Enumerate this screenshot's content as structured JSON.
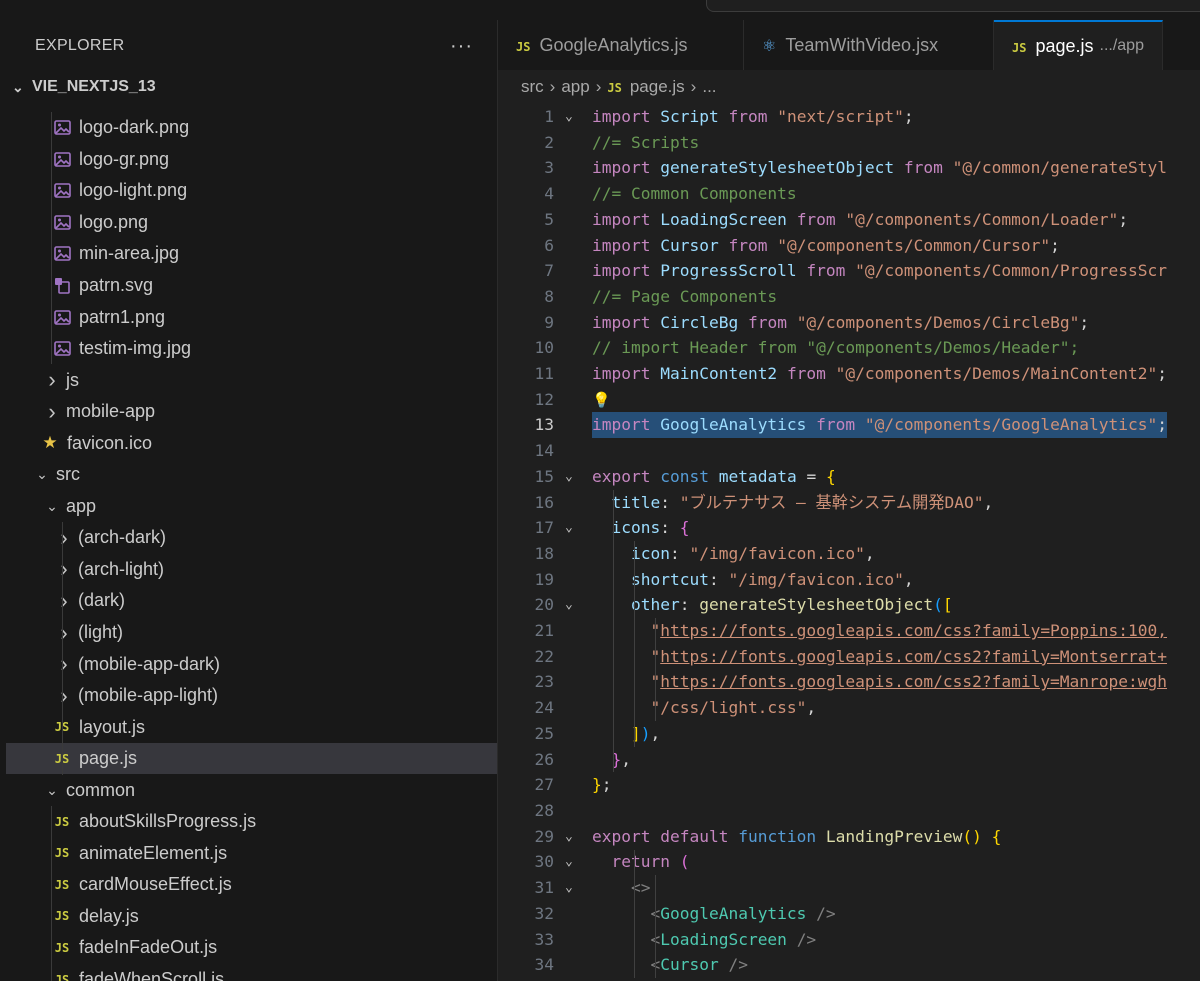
{
  "explorer": {
    "title": "EXPLORER",
    "more_label": "···",
    "project": "VIE_NEXTJS_13"
  },
  "tree": [
    {
      "label": "logo-dark.png",
      "icon": "image-icon",
      "depth": 2,
      "kind": "file"
    },
    {
      "label": "logo-gr.png",
      "icon": "image-icon",
      "depth": 2,
      "kind": "file"
    },
    {
      "label": "logo-light.png",
      "icon": "image-icon",
      "depth": 2,
      "kind": "file"
    },
    {
      "label": "logo.png",
      "icon": "image-icon",
      "depth": 2,
      "kind": "file"
    },
    {
      "label": "min-area.jpg",
      "icon": "image-icon",
      "depth": 2,
      "kind": "file"
    },
    {
      "label": "patrn.svg",
      "icon": "svg-icon",
      "depth": 2,
      "kind": "file"
    },
    {
      "label": "patrn1.png",
      "icon": "image-icon",
      "depth": 2,
      "kind": "file"
    },
    {
      "label": "testim-img.jpg",
      "icon": "image-icon",
      "depth": 2,
      "kind": "file"
    },
    {
      "label": "js",
      "icon": "chevron-right-icon",
      "depth": 1,
      "kind": "folder-collapsed"
    },
    {
      "label": "mobile-app",
      "icon": "chevron-right-icon",
      "depth": 1,
      "kind": "folder-collapsed"
    },
    {
      "label": "favicon.ico",
      "icon": "star-icon",
      "depth": 1,
      "kind": "file"
    },
    {
      "label": "src",
      "icon": "chevron-down-icon",
      "depth": 0,
      "kind": "folder-open"
    },
    {
      "label": "app",
      "icon": "chevron-down-icon",
      "depth": 1,
      "kind": "folder-open"
    },
    {
      "label": "(arch-dark)",
      "icon": "chevron-right-icon",
      "depth": 2,
      "kind": "folder-collapsed"
    },
    {
      "label": "(arch-light)",
      "icon": "chevron-right-icon",
      "depth": 2,
      "kind": "folder-collapsed"
    },
    {
      "label": "(dark)",
      "icon": "chevron-right-icon",
      "depth": 2,
      "kind": "folder-collapsed"
    },
    {
      "label": "(light)",
      "icon": "chevron-right-icon",
      "depth": 2,
      "kind": "folder-collapsed"
    },
    {
      "label": "(mobile-app-dark)",
      "icon": "chevron-right-icon",
      "depth": 2,
      "kind": "folder-collapsed"
    },
    {
      "label": "(mobile-app-light)",
      "icon": "chevron-right-icon",
      "depth": 2,
      "kind": "folder-collapsed"
    },
    {
      "label": "layout.js",
      "icon": "js-icon",
      "depth": 2,
      "kind": "file"
    },
    {
      "label": "page.js",
      "icon": "js-icon",
      "depth": 2,
      "kind": "file",
      "selected": true
    },
    {
      "label": "common",
      "icon": "chevron-down-icon",
      "depth": 1,
      "kind": "folder-open"
    },
    {
      "label": "aboutSkillsProgress.js",
      "icon": "js-icon",
      "depth": 2,
      "kind": "file"
    },
    {
      "label": "animateElement.js",
      "icon": "js-icon",
      "depth": 2,
      "kind": "file"
    },
    {
      "label": "cardMouseEffect.js",
      "icon": "js-icon",
      "depth": 2,
      "kind": "file"
    },
    {
      "label": "delay.js",
      "icon": "js-icon",
      "depth": 2,
      "kind": "file"
    },
    {
      "label": "fadeInFadeOut.js",
      "icon": "js-icon",
      "depth": 2,
      "kind": "file"
    },
    {
      "label": "fadeWhenScroll.js",
      "icon": "js-icon",
      "depth": 2,
      "kind": "file"
    }
  ],
  "tabs": [
    {
      "label": "GoogleAnalytics.js",
      "icon": "js-icon",
      "active": false
    },
    {
      "label": "TeamWithVideo.jsx",
      "icon": "react-icon",
      "active": false
    },
    {
      "label": "page.js",
      "path": ".../app",
      "icon": "js-icon",
      "active": true
    }
  ],
  "breadcrumb": [
    "src",
    "app",
    "page.js",
    "..."
  ],
  "current_line": 13,
  "code": [
    {
      "n": 1,
      "fold": "v",
      "t": [
        [
          "kw",
          "import "
        ],
        [
          "id",
          "Script "
        ],
        [
          "kw",
          "from "
        ],
        [
          "str",
          "\"next/script\""
        ],
        [
          "pun",
          ";"
        ]
      ]
    },
    {
      "n": 2,
      "t": [
        [
          "cm",
          "//= Scripts"
        ]
      ]
    },
    {
      "n": 3,
      "t": [
        [
          "kw",
          "import "
        ],
        [
          "id",
          "generateStylesheetObject "
        ],
        [
          "kw",
          "from "
        ],
        [
          "str",
          "\"@/common/generateStyl"
        ]
      ]
    },
    {
      "n": 4,
      "t": [
        [
          "cm",
          "//= Common Components"
        ]
      ]
    },
    {
      "n": 5,
      "t": [
        [
          "kw",
          "import "
        ],
        [
          "id",
          "LoadingScreen "
        ],
        [
          "kw",
          "from "
        ],
        [
          "str",
          "\"@/components/Common/Loader\""
        ],
        [
          "pun",
          ";"
        ]
      ]
    },
    {
      "n": 6,
      "t": [
        [
          "kw",
          "import "
        ],
        [
          "id",
          "Cursor "
        ],
        [
          "kw",
          "from "
        ],
        [
          "str",
          "\"@/components/Common/Cursor\""
        ],
        [
          "pun",
          ";"
        ]
      ]
    },
    {
      "n": 7,
      "t": [
        [
          "kw",
          "import "
        ],
        [
          "id",
          "ProgressScroll "
        ],
        [
          "kw",
          "from "
        ],
        [
          "str",
          "\"@/components/Common/ProgressScr"
        ]
      ]
    },
    {
      "n": 8,
      "t": [
        [
          "cm",
          "//= Page Components"
        ]
      ]
    },
    {
      "n": 9,
      "t": [
        [
          "kw",
          "import "
        ],
        [
          "id",
          "CircleBg "
        ],
        [
          "kw",
          "from "
        ],
        [
          "str",
          "\"@/components/Demos/CircleBg\""
        ],
        [
          "pun",
          ";"
        ]
      ]
    },
    {
      "n": 10,
      "t": [
        [
          "cm",
          "// import Header from \"@/components/Demos/Header\";"
        ]
      ]
    },
    {
      "n": 11,
      "t": [
        [
          "kw",
          "import "
        ],
        [
          "id",
          "MainContent2 "
        ],
        [
          "kw",
          "from "
        ],
        [
          "str",
          "\"@/components/Demos/MainContent2\""
        ],
        [
          "pun",
          ";"
        ]
      ]
    },
    {
      "n": 12,
      "bulb": true,
      "t": []
    },
    {
      "n": 13,
      "hl": true,
      "t": [
        [
          "kw",
          "import "
        ],
        [
          "id",
          "GoogleAnalytics "
        ],
        [
          "kw",
          "from "
        ],
        [
          "str",
          "\"@/components/GoogleAnalytics\""
        ],
        [
          "pun",
          ";"
        ]
      ]
    },
    {
      "n": 14,
      "t": []
    },
    {
      "n": 15,
      "fold": "v",
      "t": [
        [
          "kw",
          "export "
        ],
        [
          "kb",
          "const "
        ],
        [
          "id",
          "metadata "
        ],
        [
          "pun",
          "= "
        ],
        [
          "br1",
          "{"
        ]
      ]
    },
    {
      "n": 16,
      "t": [
        [
          "pun",
          "  "
        ],
        [
          "id",
          "title"
        ],
        [
          "pun",
          ": "
        ],
        [
          "str",
          "\"ブルテナサス – 基幹システム開発DAO\""
        ],
        [
          "pun",
          ","
        ]
      ]
    },
    {
      "n": 17,
      "fold": "v",
      "t": [
        [
          "pun",
          "  "
        ],
        [
          "id",
          "icons"
        ],
        [
          "pun",
          ": "
        ],
        [
          "br2",
          "{"
        ]
      ]
    },
    {
      "n": 18,
      "t": [
        [
          "pun",
          "    "
        ],
        [
          "id",
          "icon"
        ],
        [
          "pun",
          ": "
        ],
        [
          "str",
          "\"/img/favicon.ico\""
        ],
        [
          "pun",
          ","
        ]
      ]
    },
    {
      "n": 19,
      "t": [
        [
          "pun",
          "    "
        ],
        [
          "id",
          "shortcut"
        ],
        [
          "pun",
          ": "
        ],
        [
          "str",
          "\"/img/favicon.ico\""
        ],
        [
          "pun",
          ","
        ]
      ]
    },
    {
      "n": 20,
      "fold": "v",
      "t": [
        [
          "pun",
          "    "
        ],
        [
          "id",
          "other"
        ],
        [
          "pun",
          ": "
        ],
        [
          "fn",
          "generateStylesheetObject"
        ],
        [
          "br3",
          "("
        ],
        [
          "br1",
          "["
        ]
      ]
    },
    {
      "n": 21,
      "t": [
        [
          "pun",
          "      "
        ],
        [
          "str",
          "\""
        ],
        [
          "ul",
          "https://fonts.googleapis.com/css?family=Poppins:100,"
        ]
      ]
    },
    {
      "n": 22,
      "t": [
        [
          "pun",
          "      "
        ],
        [
          "str",
          "\""
        ],
        [
          "ul",
          "https://fonts.googleapis.com/css2?family=Montserrat+"
        ]
      ]
    },
    {
      "n": 23,
      "t": [
        [
          "pun",
          "      "
        ],
        [
          "str",
          "\""
        ],
        [
          "ul",
          "https://fonts.googleapis.com/css2?family=Manrope:wgh"
        ]
      ]
    },
    {
      "n": 24,
      "t": [
        [
          "pun",
          "      "
        ],
        [
          "str",
          "\"/css/light.css\""
        ],
        [
          "pun",
          ","
        ]
      ]
    },
    {
      "n": 25,
      "t": [
        [
          "pun",
          "    "
        ],
        [
          "br1",
          "]"
        ],
        [
          "br3",
          ")"
        ],
        [
          "pun",
          ","
        ]
      ]
    },
    {
      "n": 26,
      "t": [
        [
          "pun",
          "  "
        ],
        [
          "br2",
          "}"
        ],
        [
          "pun",
          ","
        ]
      ]
    },
    {
      "n": 27,
      "t": [
        [
          "br1",
          "}"
        ],
        [
          "pun",
          ";"
        ]
      ]
    },
    {
      "n": 28,
      "t": []
    },
    {
      "n": 29,
      "fold": "v",
      "t": [
        [
          "kw",
          "export "
        ],
        [
          "kw",
          "default "
        ],
        [
          "kb",
          "function "
        ],
        [
          "fn",
          "LandingPreview"
        ],
        [
          "br1",
          "() {"
        ]
      ]
    },
    {
      "n": 30,
      "fold": "v",
      "t": [
        [
          "pun",
          "  "
        ],
        [
          "kw",
          "return "
        ],
        [
          "br2",
          "("
        ]
      ]
    },
    {
      "n": 31,
      "fold": "v",
      "t": [
        [
          "pun",
          "    "
        ],
        [
          "ang",
          "<>"
        ]
      ]
    },
    {
      "n": 32,
      "t": [
        [
          "pun",
          "      "
        ],
        [
          "ang",
          "<"
        ],
        [
          "tag",
          "GoogleAnalytics "
        ],
        [
          "ang",
          "/>"
        ]
      ]
    },
    {
      "n": 33,
      "t": [
        [
          "pun",
          "      "
        ],
        [
          "ang",
          "<"
        ],
        [
          "tag",
          "LoadingScreen "
        ],
        [
          "ang",
          "/>"
        ]
      ]
    },
    {
      "n": 34,
      "t": [
        [
          "pun",
          "      "
        ],
        [
          "ang",
          "<"
        ],
        [
          "tag",
          "Cursor "
        ],
        [
          "ang",
          "/>"
        ]
      ]
    }
  ]
}
